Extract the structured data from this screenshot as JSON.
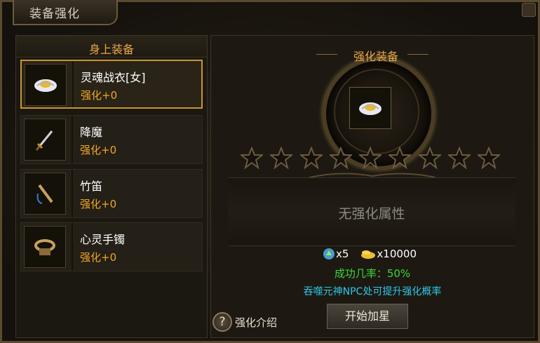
{
  "window": {
    "title": "装备强化"
  },
  "left_panel": {
    "header": "身上装备",
    "items": [
      {
        "name": "灵魂战衣[女]",
        "level": "强化+0",
        "icon": "armor-icon",
        "selected": true
      },
      {
        "name": "降魔",
        "level": "强化+0",
        "icon": "sword-icon",
        "selected": false
      },
      {
        "name": "竹笛",
        "level": "强化+0",
        "icon": "flute-icon",
        "selected": false
      },
      {
        "name": "心灵手镯",
        "level": "强化+0",
        "icon": "bracelet-icon",
        "selected": false
      }
    ]
  },
  "enhance": {
    "title": "强化装备",
    "slot_icon": "armor-icon",
    "stars_total": 9,
    "stars_filled": 0,
    "attributes_text": "无强化属性",
    "cost_gem": "x5",
    "cost_gold": "x10000",
    "success_rate": "成功几率：50%",
    "hint": "吞噬元神NPC处可提升强化概率",
    "help_label": "强化介绍",
    "help_icon": "?",
    "start_button": "开始加星"
  },
  "colors": {
    "gold_text": "#e8a84a",
    "level_text": "#f0a824",
    "success": "#3cd43c",
    "hint": "#2ec8e8"
  }
}
